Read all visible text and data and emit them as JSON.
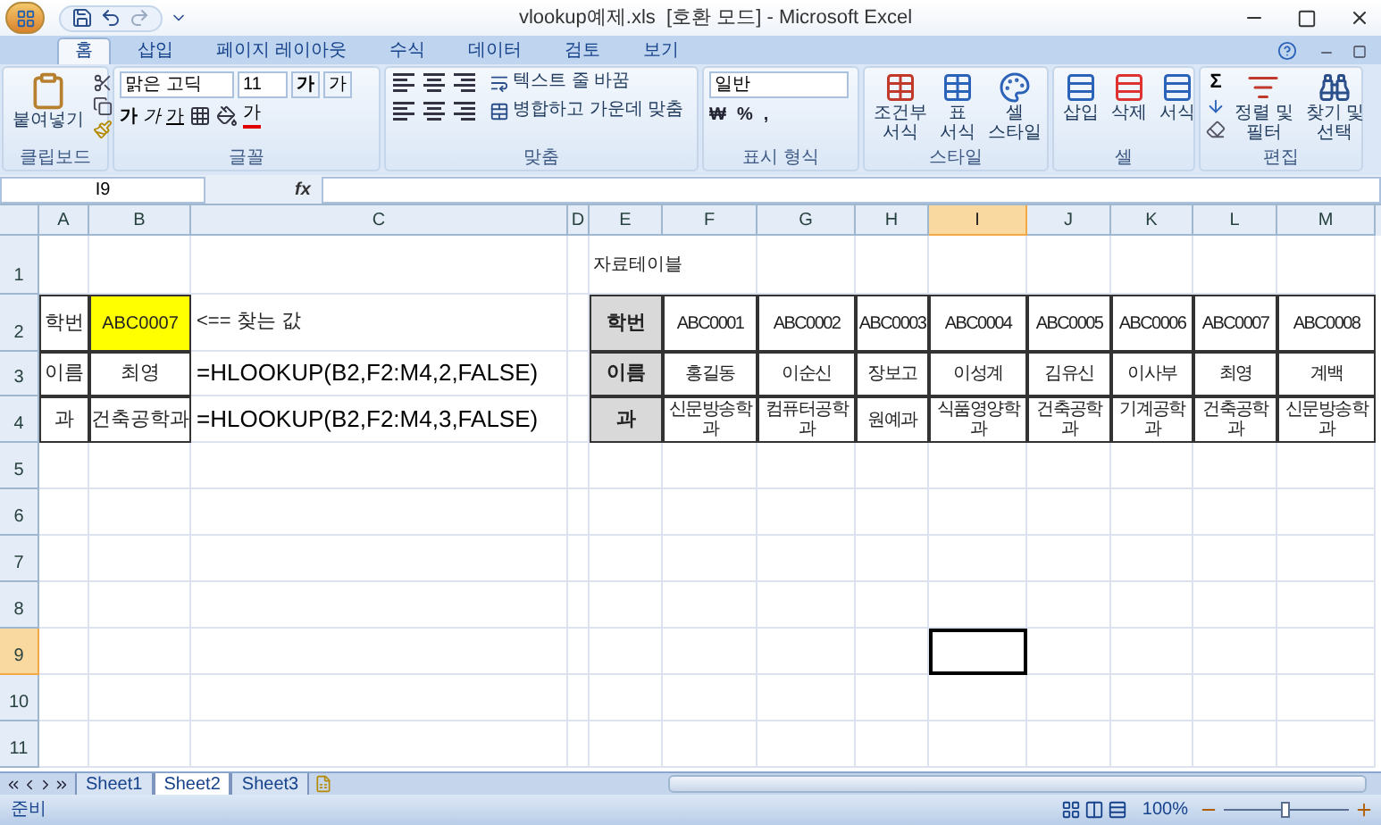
{
  "window": {
    "title": "vlookup예제.xls  [호환 모드] - Microsoft Excel"
  },
  "ribbon_tabs": [
    {
      "label": "홈",
      "selected": true
    },
    {
      "label": "삽입",
      "selected": false
    },
    {
      "label": "페이지 레이아웃",
      "selected": false
    },
    {
      "label": "수식",
      "selected": false
    },
    {
      "label": "데이터",
      "selected": false
    },
    {
      "label": "검토",
      "selected": false
    },
    {
      "label": "보기",
      "selected": false
    }
  ],
  "ribbon": {
    "clipboard": {
      "paste": "붙여넣기",
      "label": "클립보드"
    },
    "font": {
      "name": "맑은 고딕",
      "size": "11",
      "grow": "가",
      "shrink": "가",
      "bold": "가",
      "italic": "가",
      "underline": "가",
      "color_letter": "가",
      "label": "글꼴"
    },
    "alignment": {
      "wrap": "텍스트 줄 바꿈",
      "merge": "병합하고 가운데 맞춤",
      "label": "맞춤"
    },
    "number": {
      "format": "일반",
      "currency": "₩",
      "percent": "%",
      "comma": ",",
      "label": "표시 형식"
    },
    "styles": {
      "buttons": [
        {
          "lines": [
            "조건부",
            "서식"
          ]
        },
        {
          "lines": [
            "표",
            "서식"
          ]
        },
        {
          "lines": [
            "셀",
            "스타일"
          ]
        }
      ],
      "label": "스타일"
    },
    "cells": {
      "buttons": [
        "삽입",
        "삭제",
        "서식"
      ],
      "label": "셀"
    },
    "editing": {
      "sigma": "Σ",
      "buttons": [
        {
          "lines": [
            "정렬 및",
            "필터"
          ]
        },
        {
          "lines": [
            "찾기 및",
            "선택"
          ]
        }
      ],
      "label": "편집"
    }
  },
  "formula_bar": {
    "name_box": "I9",
    "fx": "fx"
  },
  "columns": [
    {
      "label": "A",
      "selected": false
    },
    {
      "label": "B",
      "selected": false
    },
    {
      "label": "C",
      "selected": false
    },
    {
      "label": "D",
      "selected": false
    },
    {
      "label": "E",
      "selected": false
    },
    {
      "label": "F",
      "selected": false
    },
    {
      "label": "G",
      "selected": false
    },
    {
      "label": "H",
      "selected": false
    },
    {
      "label": "I",
      "selected": true
    },
    {
      "label": "J",
      "selected": false
    },
    {
      "label": "K",
      "selected": false
    },
    {
      "label": "L",
      "selected": false
    },
    {
      "label": "M",
      "selected": false
    }
  ],
  "rows": [
    {
      "label": "1",
      "selected": false,
      "cells": [
        null,
        null,
        null,
        null,
        {
          "kind": "title",
          "text": "자료테이블"
        },
        null,
        null,
        null,
        null,
        null,
        null,
        null,
        null
      ]
    },
    {
      "label": "2",
      "selected": false,
      "cells": [
        {
          "kind": "label",
          "text": "학번"
        },
        {
          "kind": "lookup",
          "text": "ABC0007"
        },
        {
          "kind": "note",
          "text": "<== 찾는 값"
        },
        null,
        {
          "kind": "key",
          "text": "학번"
        },
        {
          "kind": "value",
          "text": "ABC0001"
        },
        {
          "kind": "value",
          "text": "ABC0002"
        },
        {
          "kind": "value",
          "text": "ABC0003"
        },
        {
          "kind": "value",
          "text": "ABC0004"
        },
        {
          "kind": "value",
          "text": "ABC0005"
        },
        {
          "kind": "value",
          "text": "ABC0006"
        },
        {
          "kind": "value",
          "text": "ABC0007"
        },
        {
          "kind": "value",
          "text": "ABC0008"
        }
      ]
    },
    {
      "label": "3",
      "selected": false,
      "cells": [
        {
          "kind": "label",
          "text": "이름"
        },
        {
          "kind": "label",
          "text": "최영"
        },
        {
          "kind": "formula",
          "text": "=HLOOKUP(B2,F2:M4,2,FALSE)"
        },
        null,
        {
          "kind": "key",
          "text": "이름"
        },
        {
          "kind": "value",
          "text": "홍길동"
        },
        {
          "kind": "value",
          "text": "이순신"
        },
        {
          "kind": "value",
          "text": "장보고"
        },
        {
          "kind": "value",
          "text": "이성계"
        },
        {
          "kind": "value",
          "text": "김유신"
        },
        {
          "kind": "value",
          "text": "이사부"
        },
        {
          "kind": "value",
          "text": "최영"
        },
        {
          "kind": "value",
          "text": "계백"
        }
      ]
    },
    {
      "label": "4",
      "selected": false,
      "cells": [
        {
          "kind": "label",
          "text": "과"
        },
        {
          "kind": "label",
          "text": "건축공학과"
        },
        {
          "kind": "formula",
          "text": "=HLOOKUP(B2,F2:M4,3,FALSE)"
        },
        null,
        {
          "kind": "key",
          "text": "과"
        },
        {
          "kind": "value",
          "text": "신문방송학과"
        },
        {
          "kind": "value",
          "text": "컴퓨터공학과"
        },
        {
          "kind": "value",
          "text": "원예과"
        },
        {
          "kind": "value",
          "text": "식품영양학과"
        },
        {
          "kind": "value",
          "text": "건축공학과"
        },
        {
          "kind": "value",
          "text": "기계공학과"
        },
        {
          "kind": "value",
          "text": "건축공학과"
        },
        {
          "kind": "value",
          "text": "신문방송학과"
        }
      ]
    },
    {
      "label": "5",
      "selected": false
    },
    {
      "label": "6",
      "selected": false
    },
    {
      "label": "7",
      "selected": false
    },
    {
      "label": "8",
      "selected": false
    },
    {
      "label": "9",
      "selected": true
    },
    {
      "label": "10",
      "selected": false
    },
    {
      "label": "11",
      "selected": false
    }
  ],
  "sheets": [
    {
      "label": "Sheet1",
      "selected": false
    },
    {
      "label": "Sheet2",
      "selected": true
    },
    {
      "label": "Sheet3",
      "selected": false
    }
  ],
  "status_bar": {
    "status": "준비",
    "zoom": "100%",
    "zoom_level": {
      "level": 0.5
    }
  }
}
